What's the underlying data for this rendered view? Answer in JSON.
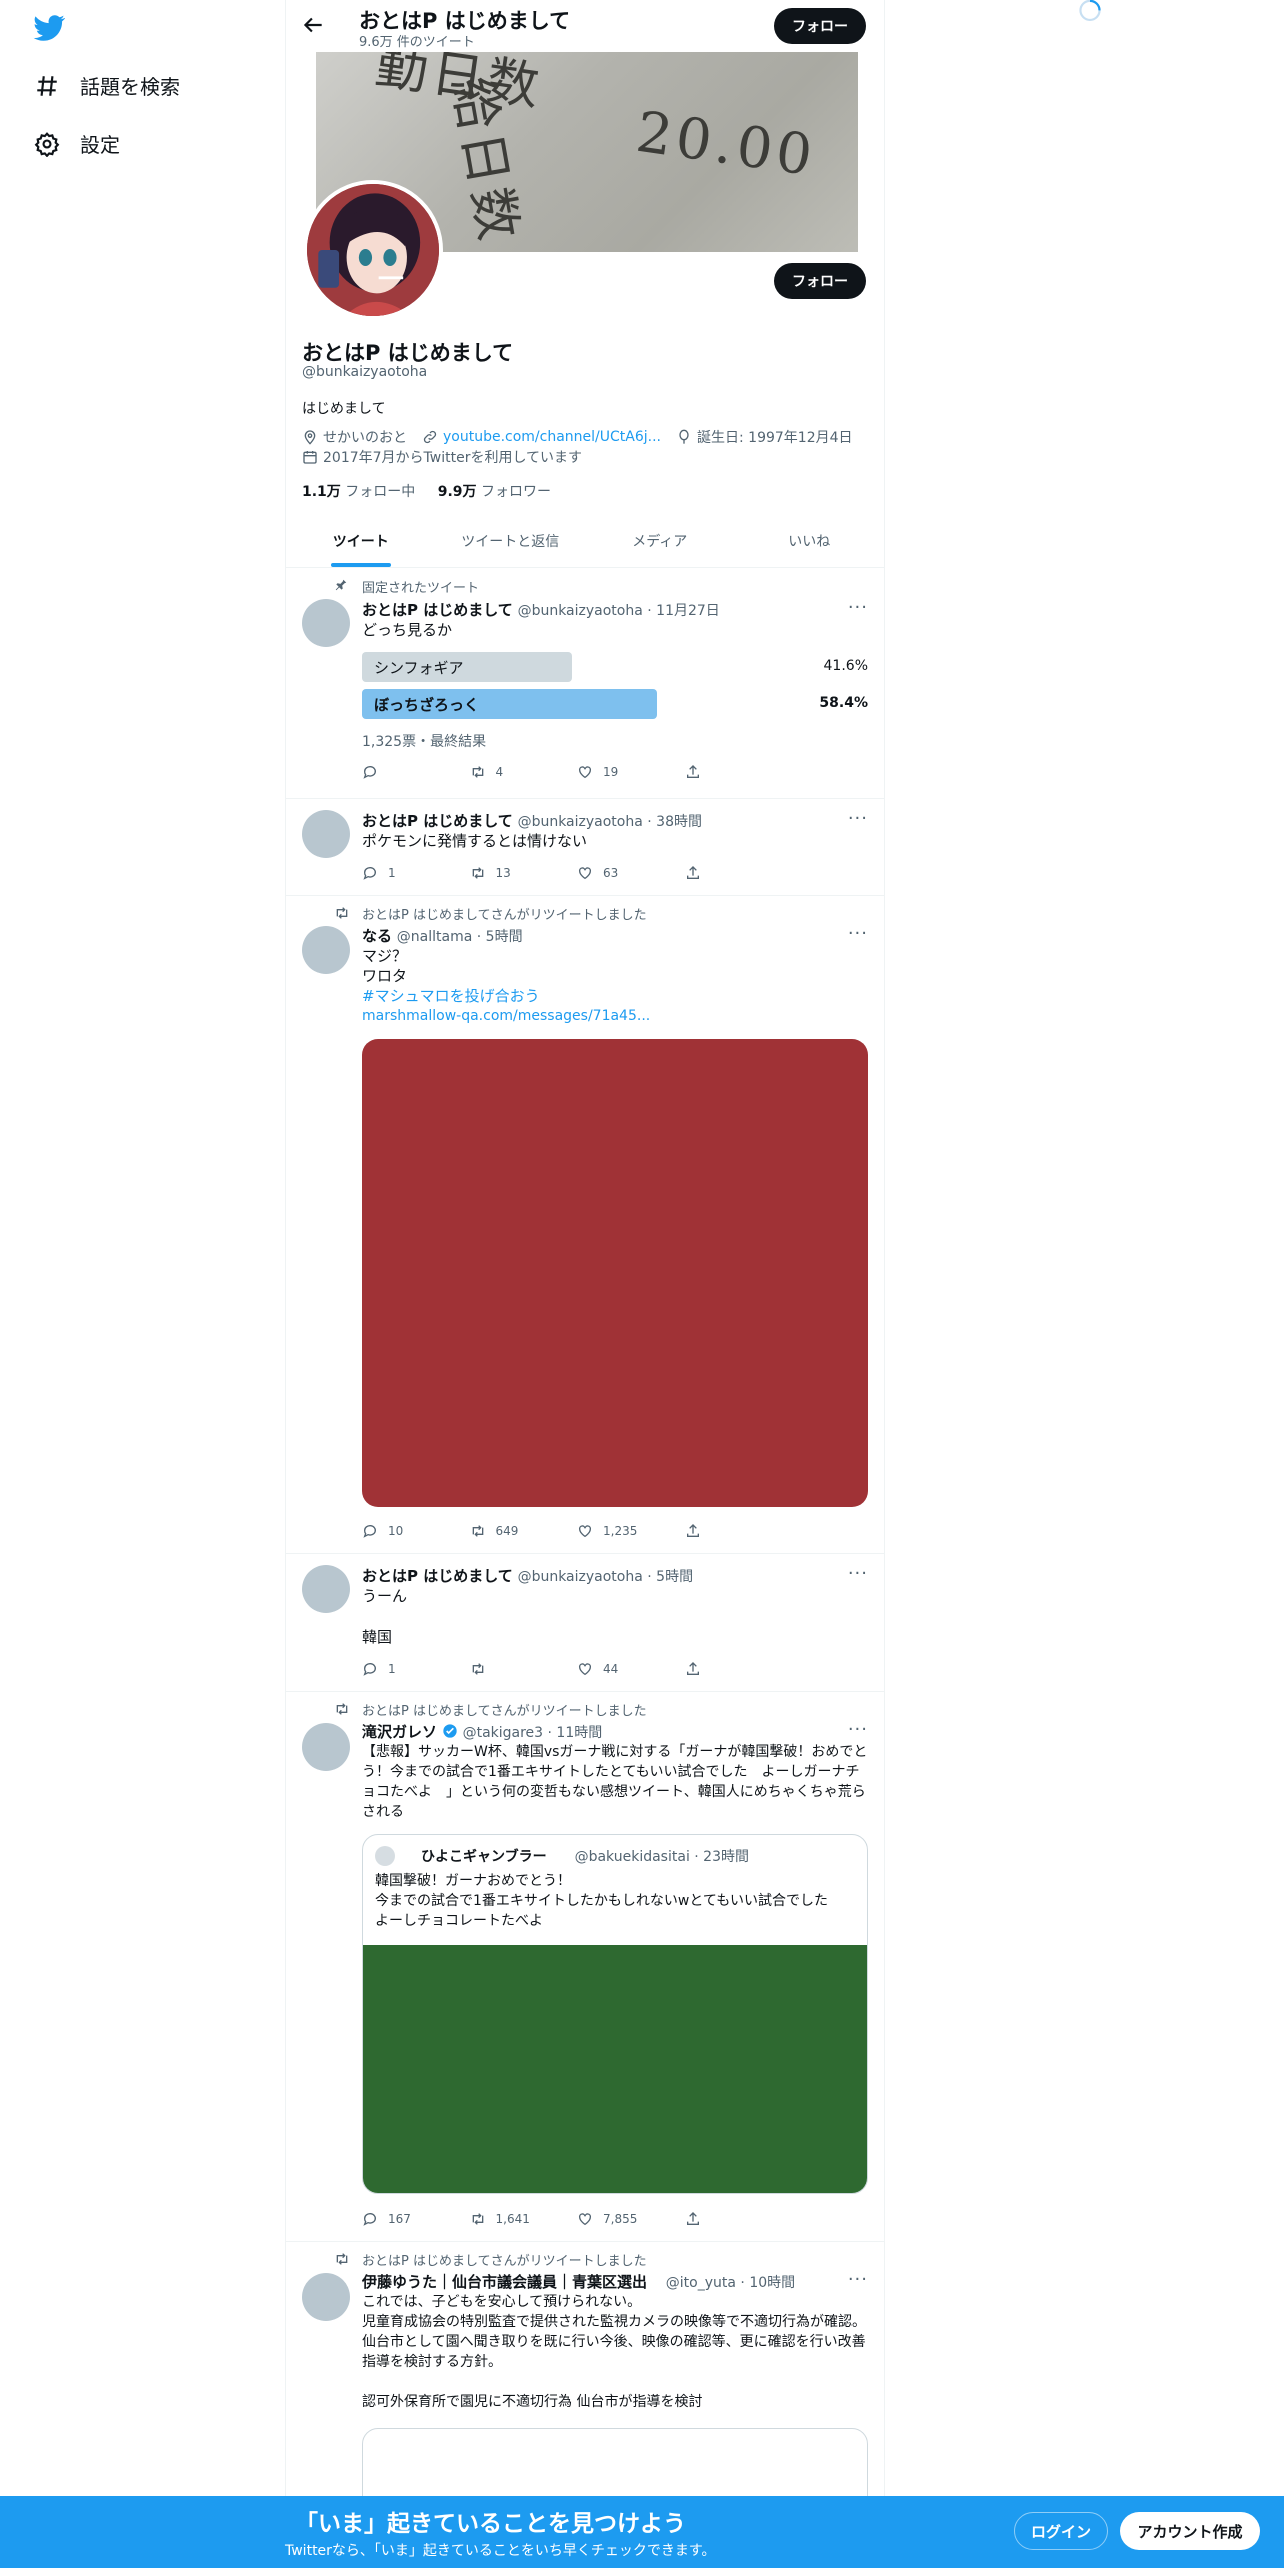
{
  "sidebar": {
    "items": [
      {
        "label": "話題を検索",
        "icon": "hashtag-icon"
      },
      {
        "label": "設定",
        "icon": "gear-icon"
      }
    ]
  },
  "header": {
    "title": "おとはP はじめまして",
    "subtitle": "9.6万 件のツイート",
    "follow_label": "フォロー"
  },
  "profile": {
    "name": "おとはP はじめまして",
    "handle": "@bunkaizyaotoha",
    "bio": "はじめまして",
    "location": "せかいのおと",
    "url": "youtube.com/channel/UCtA6j...",
    "birthday": "誕生日: 1997年12月4日",
    "joined": "2017年7月からTwitterを利用しています",
    "following_count": "1.1万",
    "following_label": "フォロー中",
    "followers_count": "9.9万",
    "followers_label": "フォロワー",
    "follow_label": "フォロー",
    "banner_text1": "勤日数",
    "banner_text2": "給日数",
    "banner_text3": "20.00"
  },
  "tabs": [
    {
      "label": "ツイート",
      "active": true
    },
    {
      "label": "ツイートと返信",
      "active": false
    },
    {
      "label": "メディア",
      "active": false
    },
    {
      "label": "いいね",
      "active": false
    }
  ],
  "tweets": [
    {
      "social": "固定されたツイート",
      "name": "おとはP はじめまして",
      "meta": "@bunkaizyaotoha · 11月27日",
      "text": "どっち見るか",
      "poll": [
        {
          "label": "シンフォギア",
          "pct": "41.6%",
          "value": 41.6
        },
        {
          "label": "ぼっちざろっく",
          "pct": "58.4%",
          "value": 58.4
        }
      ],
      "poll_footer": "1,325票・最終結果",
      "reply": "",
      "retweet": "4",
      "like": "19"
    },
    {
      "name": "おとはP はじめまして",
      "meta": "@bunkaizyaotoha · 38時間",
      "text": "ポケモンに発情するとは情けない",
      "reply": "1",
      "retweet": "13",
      "like": "63"
    },
    {
      "social": "おとはP はじめましてさんがリツイートしました",
      "name": "なる",
      "meta": "@nalltama · 5時間",
      "lines": [
        "マジ？",
        "ワロタ"
      ],
      "hashtag": "#マシュマロを投げ合おう",
      "link": "marshmallow-qa.com/messages/71a45...",
      "media_color": "#a03236",
      "reply": "10",
      "retweet": "649",
      "like": "1,235"
    },
    {
      "name": "おとはP はじめまして",
      "meta": "@bunkaizyaotoha · 5時間",
      "lines": [
        "うーん",
        "",
        "韓国"
      ],
      "reply": "1",
      "retweet": "",
      "like": "44"
    },
    {
      "social": "おとはP はじめましてさんがリツイートしました",
      "name": "滝沢ガレソ",
      "meta": "@takigare3 · 11時間",
      "text": "【悲報】サッカーW杯、韓国vsガーナ戦に対する「ガーナが韓国撃破！おめでとう！今までの試合で1番エキサイトしたとてもいい試合でした　よーしガーナチョコたべよ　」という何の変哲もない感想ツイート、韓国人にめちゃくちゃ荒らされる",
      "quote": {
        "name": "ひよこギャンブラー",
        "meta": "@bakuekidasitai · 23時間",
        "text": "韓国撃破！ガーナおめでとう！\n今までの試合で1番エキサイトしたかもしれないwとてもいい試合でした　よーしチョコレートたべよ",
        "media_color": "#2e6930"
      },
      "reply": "167",
      "retweet": "1,641",
      "like": "7,855"
    },
    {
      "social": "おとはP はじめましてさんがリツイートしました",
      "name": "伊藤ゆうた｜仙台市議会議員｜青葉区選出",
      "meta": "@ito_yuta · 10時間",
      "text": "これでは、子どもを安心して預けられない。\n児童育成協会の特別監査で提供された監視カメラの映像等で不適切行為が確認。仙台市として園へ聞き取りを既に行い今後、映像の確認等、更に確認を行い改善指導を検討する方針。\n\n認可外保育所で園児に不適切行為 仙台市が指導を検討"
    }
  ],
  "bottom_bar": {
    "title": "「いま」起きていることを見つけよう",
    "subtitle": "Twitterなら、「いま」起きていることをいち早くチェックできます。",
    "login_label": "ログイン",
    "signup_label": "アカウント作成"
  },
  "colors": {
    "accent": "#1d9bf0",
    "poll_winner": "#7ec0ee",
    "poll_other": "#cfd9de"
  }
}
